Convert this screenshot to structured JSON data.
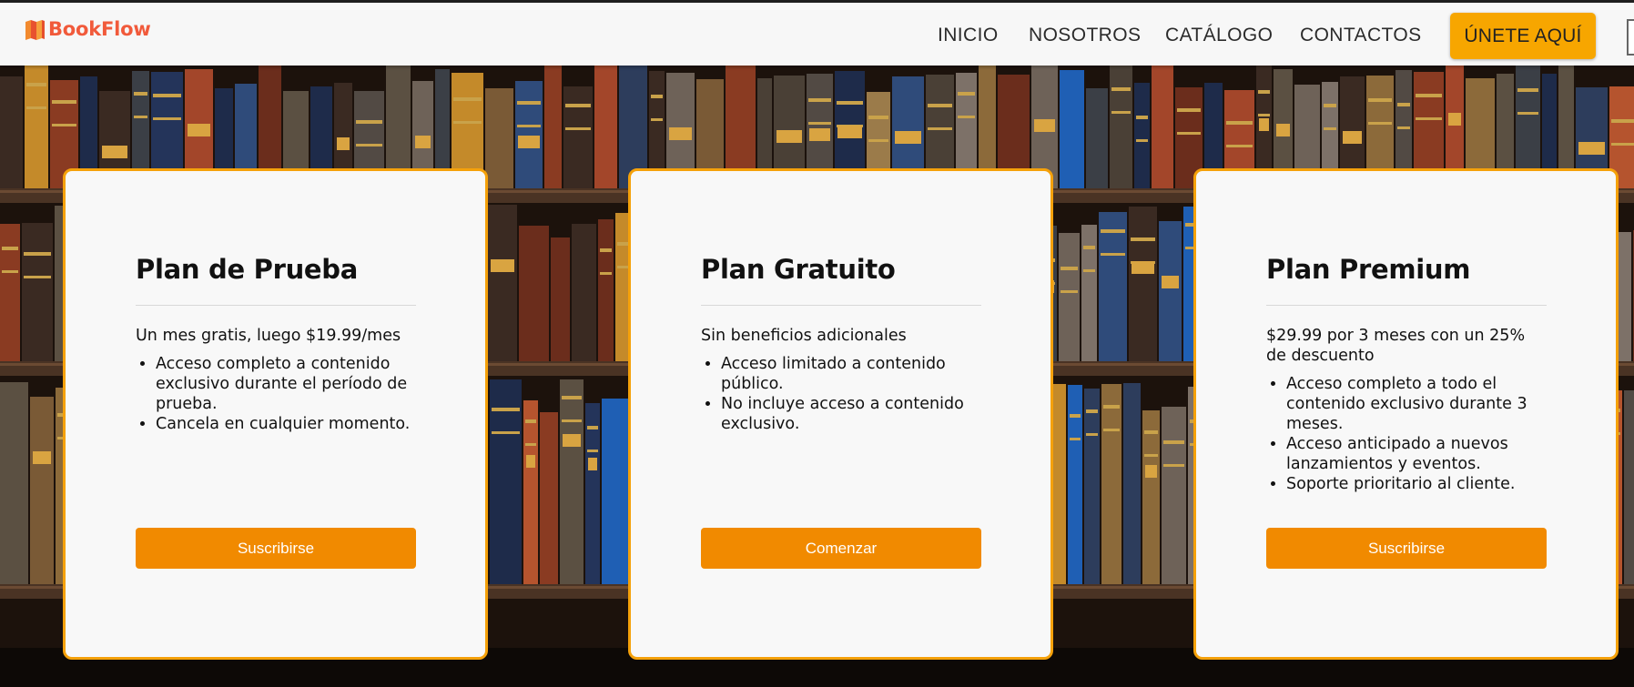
{
  "brand": {
    "name": "BookFlow",
    "color": "#f15a3b"
  },
  "nav": {
    "items": [
      {
        "label": "INICIO"
      },
      {
        "label": "NOSOTROS"
      },
      {
        "label": "CATÁLOGO"
      },
      {
        "label": "CONTACTOS"
      }
    ],
    "cta_label": "ÚNETE AQUÍ",
    "cta_color": "#f7a600"
  },
  "plans": [
    {
      "title": "Plan de Prueba",
      "price": "Un mes gratis, luego $19.99/mes",
      "features": [
        "Acceso completo a contenido exclusivo durante el período de prueba.",
        "Cancela en cualquier momento."
      ],
      "button": "Suscribirse"
    },
    {
      "title": "Plan Gratuito",
      "price": "Sin beneficios adicionales",
      "features": [
        "Acceso limitado a contenido público.",
        "No incluye acceso a contenido exclusivo."
      ],
      "button": "Comenzar"
    },
    {
      "title": "Plan Premium",
      "price": "$29.99 por 3 meses con un 25% de descuento",
      "features": [
        "Acceso completo a todo el contenido exclusivo durante 3 meses.",
        "Acceso anticipado a nuevos lanzamientos y eventos.",
        "Soporte prioritario al cliente."
      ],
      "button": "Suscribirse"
    }
  ],
  "colors": {
    "accent": "#f18a00",
    "card_border": "#f5a10a",
    "card_bg": "#f8f8f8"
  }
}
